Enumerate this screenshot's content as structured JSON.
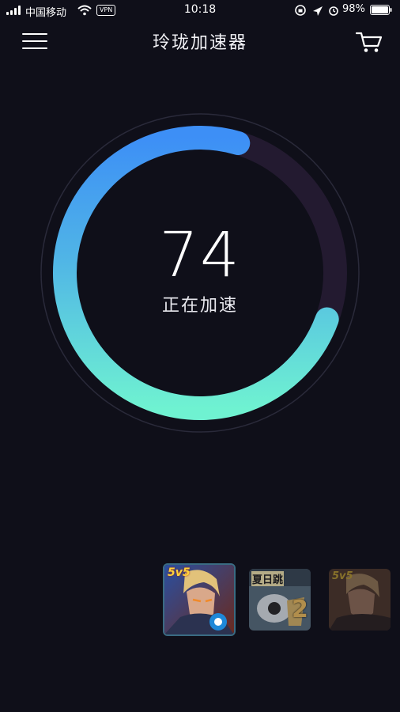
{
  "status_bar": {
    "carrier": "中国移动",
    "vpn": "VPN",
    "time": "10:18",
    "battery": "98%"
  },
  "header": {
    "title": "玲珑加速器"
  },
  "gauge": {
    "value": "74",
    "status": "正在加速",
    "progress_percent": 74,
    "colors": {
      "start": "#6ff0cf",
      "end": "#3d8ff6",
      "track": "#231a30",
      "ring": "#2a2a3a"
    }
  },
  "games": [
    {
      "name": "5v5-moba-game",
      "badge": "5v5",
      "selected": true
    },
    {
      "name": "summer-jump-2-game",
      "badge": "夏日跳",
      "number": "2",
      "selected": false
    },
    {
      "name": "5v5-moba-game-alt",
      "badge": "5v5",
      "selected": false
    }
  ]
}
